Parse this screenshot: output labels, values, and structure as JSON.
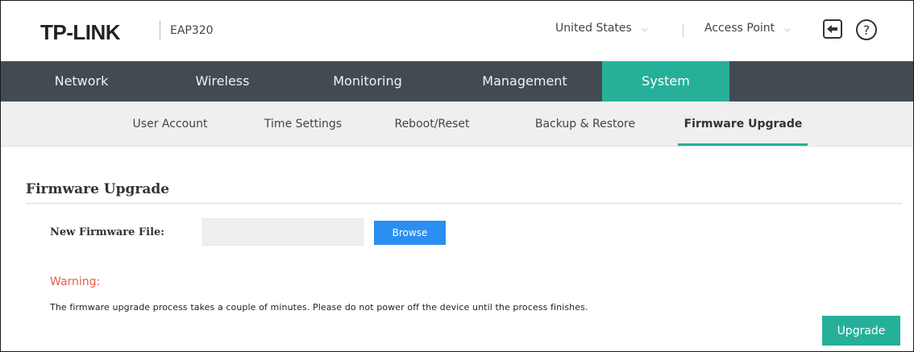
{
  "header": {
    "logo": "TP-LINK",
    "model": "EAP320",
    "region": "United States",
    "mode": "Access Point",
    "icons": {
      "logout": "logout-icon",
      "help": "help-icon",
      "chevron": "chevron-down-icon"
    }
  },
  "main_nav": {
    "tabs": [
      {
        "label": "Network"
      },
      {
        "label": "Wireless"
      },
      {
        "label": "Monitoring"
      },
      {
        "label": "Management"
      },
      {
        "label": "System",
        "active": true
      }
    ]
  },
  "sub_nav": {
    "tabs": [
      {
        "label": "User Account"
      },
      {
        "label": "Time Settings"
      },
      {
        "label": "Reboot/Reset"
      },
      {
        "label": "Backup & Restore"
      },
      {
        "label": "Firmware Upgrade",
        "active": true
      }
    ]
  },
  "content": {
    "section_title": "Firmware Upgrade",
    "field_label": "New Firmware File:",
    "file_value": "",
    "browse_label": "Browse",
    "warning_label": "Warning:",
    "warning_text": "The firmware upgrade process takes a couple of minutes. Please do not power off the device until the process finishes.",
    "upgrade_label": "Upgrade"
  },
  "colors": {
    "accent": "#26b09a",
    "nav_bg": "#434a52",
    "subnav_bg": "#efefef",
    "browse": "#2b8ff1",
    "warning": "#e85c4a"
  }
}
